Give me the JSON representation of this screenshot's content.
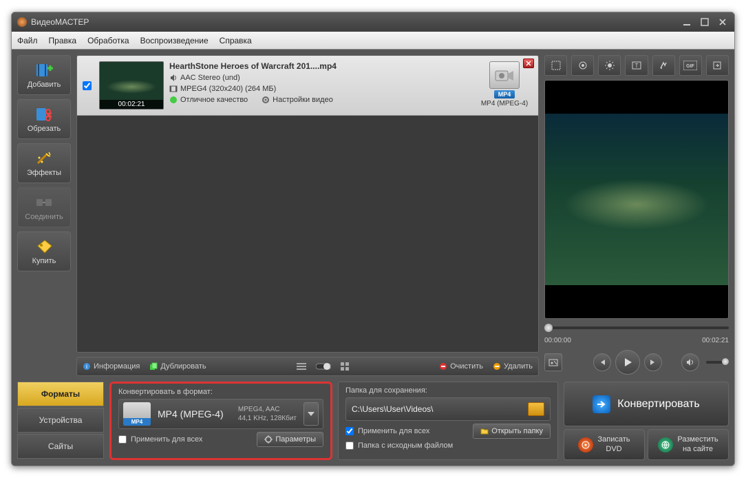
{
  "title": "ВидеоМАСТЕР",
  "menu": {
    "file": "Файл",
    "edit": "Правка",
    "process": "Обработка",
    "playback": "Воспроизведение",
    "help": "Справка"
  },
  "sidebar": {
    "add": "Добавить",
    "cut": "Обрезать",
    "effects": "Эффекты",
    "join": "Соединить",
    "buy": "Купить"
  },
  "file": {
    "name": "HearthStone  Heroes of Warcraft 201....mp4",
    "audio": "AAC Stereo (und)",
    "video": "MPEG4 (320x240) (264 МБ)",
    "quality": "Отличное качество",
    "settings": "Настройки видео",
    "duration": "00:02:21",
    "format_badge": "MP4",
    "format_label": "MP4 (MPEG-4)"
  },
  "listbar": {
    "info": "Информация",
    "duplicate": "Дублировать",
    "clear": "Очистить",
    "delete": "Удалить"
  },
  "preview": {
    "start": "00:00:00",
    "end": "00:02:21"
  },
  "tabs": {
    "formats": "Форматы",
    "devices": "Устройства",
    "sites": "Сайты"
  },
  "convert_panel": {
    "header": "Конвертировать в формат:",
    "format_name": "MP4 (MPEG-4)",
    "codec_line": "MPEG4, AAC",
    "audio_line": "44,1 KHz, 128Кбит",
    "icon_badge": "MP4",
    "apply_all": "Применить для всех",
    "params": "Параметры"
  },
  "save_panel": {
    "header": "Папка для сохранения:",
    "path": "C:\\Users\\User\\Videos\\",
    "apply_all": "Применить для всех",
    "source_folder": "Папка с исходным файлом",
    "open_folder": "Открыть папку"
  },
  "actions": {
    "convert": "Конвертировать",
    "dvd": "Записать\nDVD",
    "upload": "Разместить\nна сайте"
  }
}
